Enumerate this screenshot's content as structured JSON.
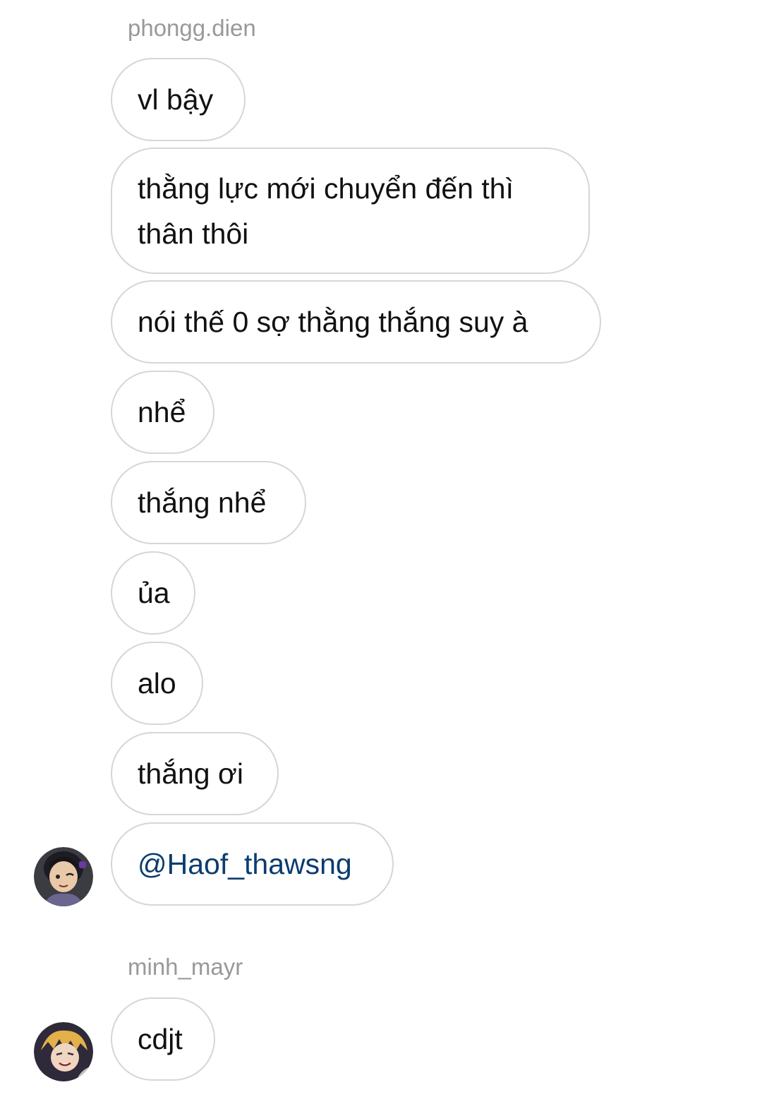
{
  "groups": [
    {
      "sender": "phongg.dien",
      "messages": [
        "vl bậy",
        "thằng lực mới chuyển đến thì thân thôi",
        "nói thế 0 sợ thằng thắng suy à",
        "nhể",
        "thắng nhể",
        "ủa",
        "alo",
        "thắng ơi",
        "@Haof_thawsng"
      ],
      "avatar_icon": "user-avatar-icon"
    },
    {
      "sender": "minh_mayr",
      "messages": [
        "cdjt"
      ],
      "avatar_icon": "user-avatar-icon"
    }
  ],
  "colors": {
    "sender_name": "#999999",
    "bubble_border": "#d6d6d6",
    "text": "#111111",
    "mention": "#0b3c6f"
  }
}
